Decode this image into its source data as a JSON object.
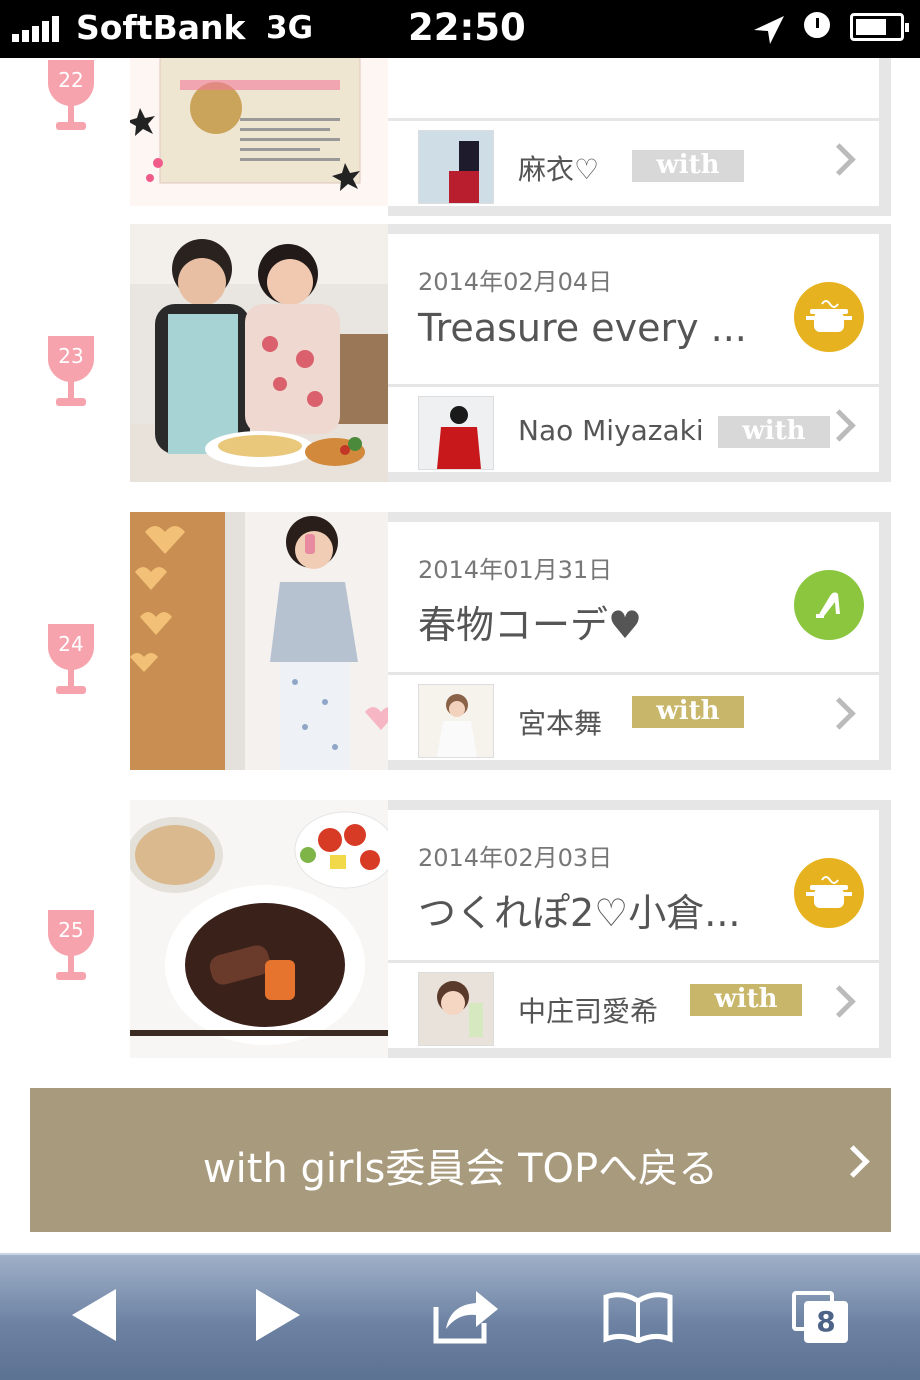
{
  "status_bar": {
    "carrier": "SoftBank",
    "network": "3G",
    "time": "22:50",
    "battery_level": 0.72
  },
  "ranking": [
    {
      "rank": "22",
      "date": "",
      "title": "",
      "user": "麻衣♡",
      "with_label": "with",
      "category_icon": "cooking-pot-icon",
      "badge_color": "#e7b21f",
      "with_color": "#d8d8d8"
    },
    {
      "rank": "23",
      "date": "2014年02月04日",
      "title": "Treasure every ...",
      "user": "Nao Miyazaki",
      "with_label": "with",
      "category_icon": "cooking-pot-icon",
      "badge_color": "#e7b21f",
      "with_color": "#d8d8d8"
    },
    {
      "rank": "24",
      "date": "2014年01月31日",
      "title": "春物コーデ♥",
      "user": "宮本舞",
      "with_label": "with",
      "category_icon": "high-heel-icon",
      "badge_color": "#8cc63f",
      "with_color": "#c8b66a"
    },
    {
      "rank": "25",
      "date": "2014年02月03日",
      "title": "つくれぽ2♡小倉...",
      "user": "中庄司愛希",
      "with_label": "with",
      "category_icon": "cooking-pot-icon",
      "badge_color": "#e7b21f",
      "with_color": "#c8b66a"
    }
  ],
  "back_button": {
    "label": "with girls委員会 TOPへ戻る"
  },
  "toolbar": {
    "tab_count": "8"
  },
  "colors": {
    "rank_pink": "#f7a3ae",
    "button_brown": "#a89a7c"
  }
}
